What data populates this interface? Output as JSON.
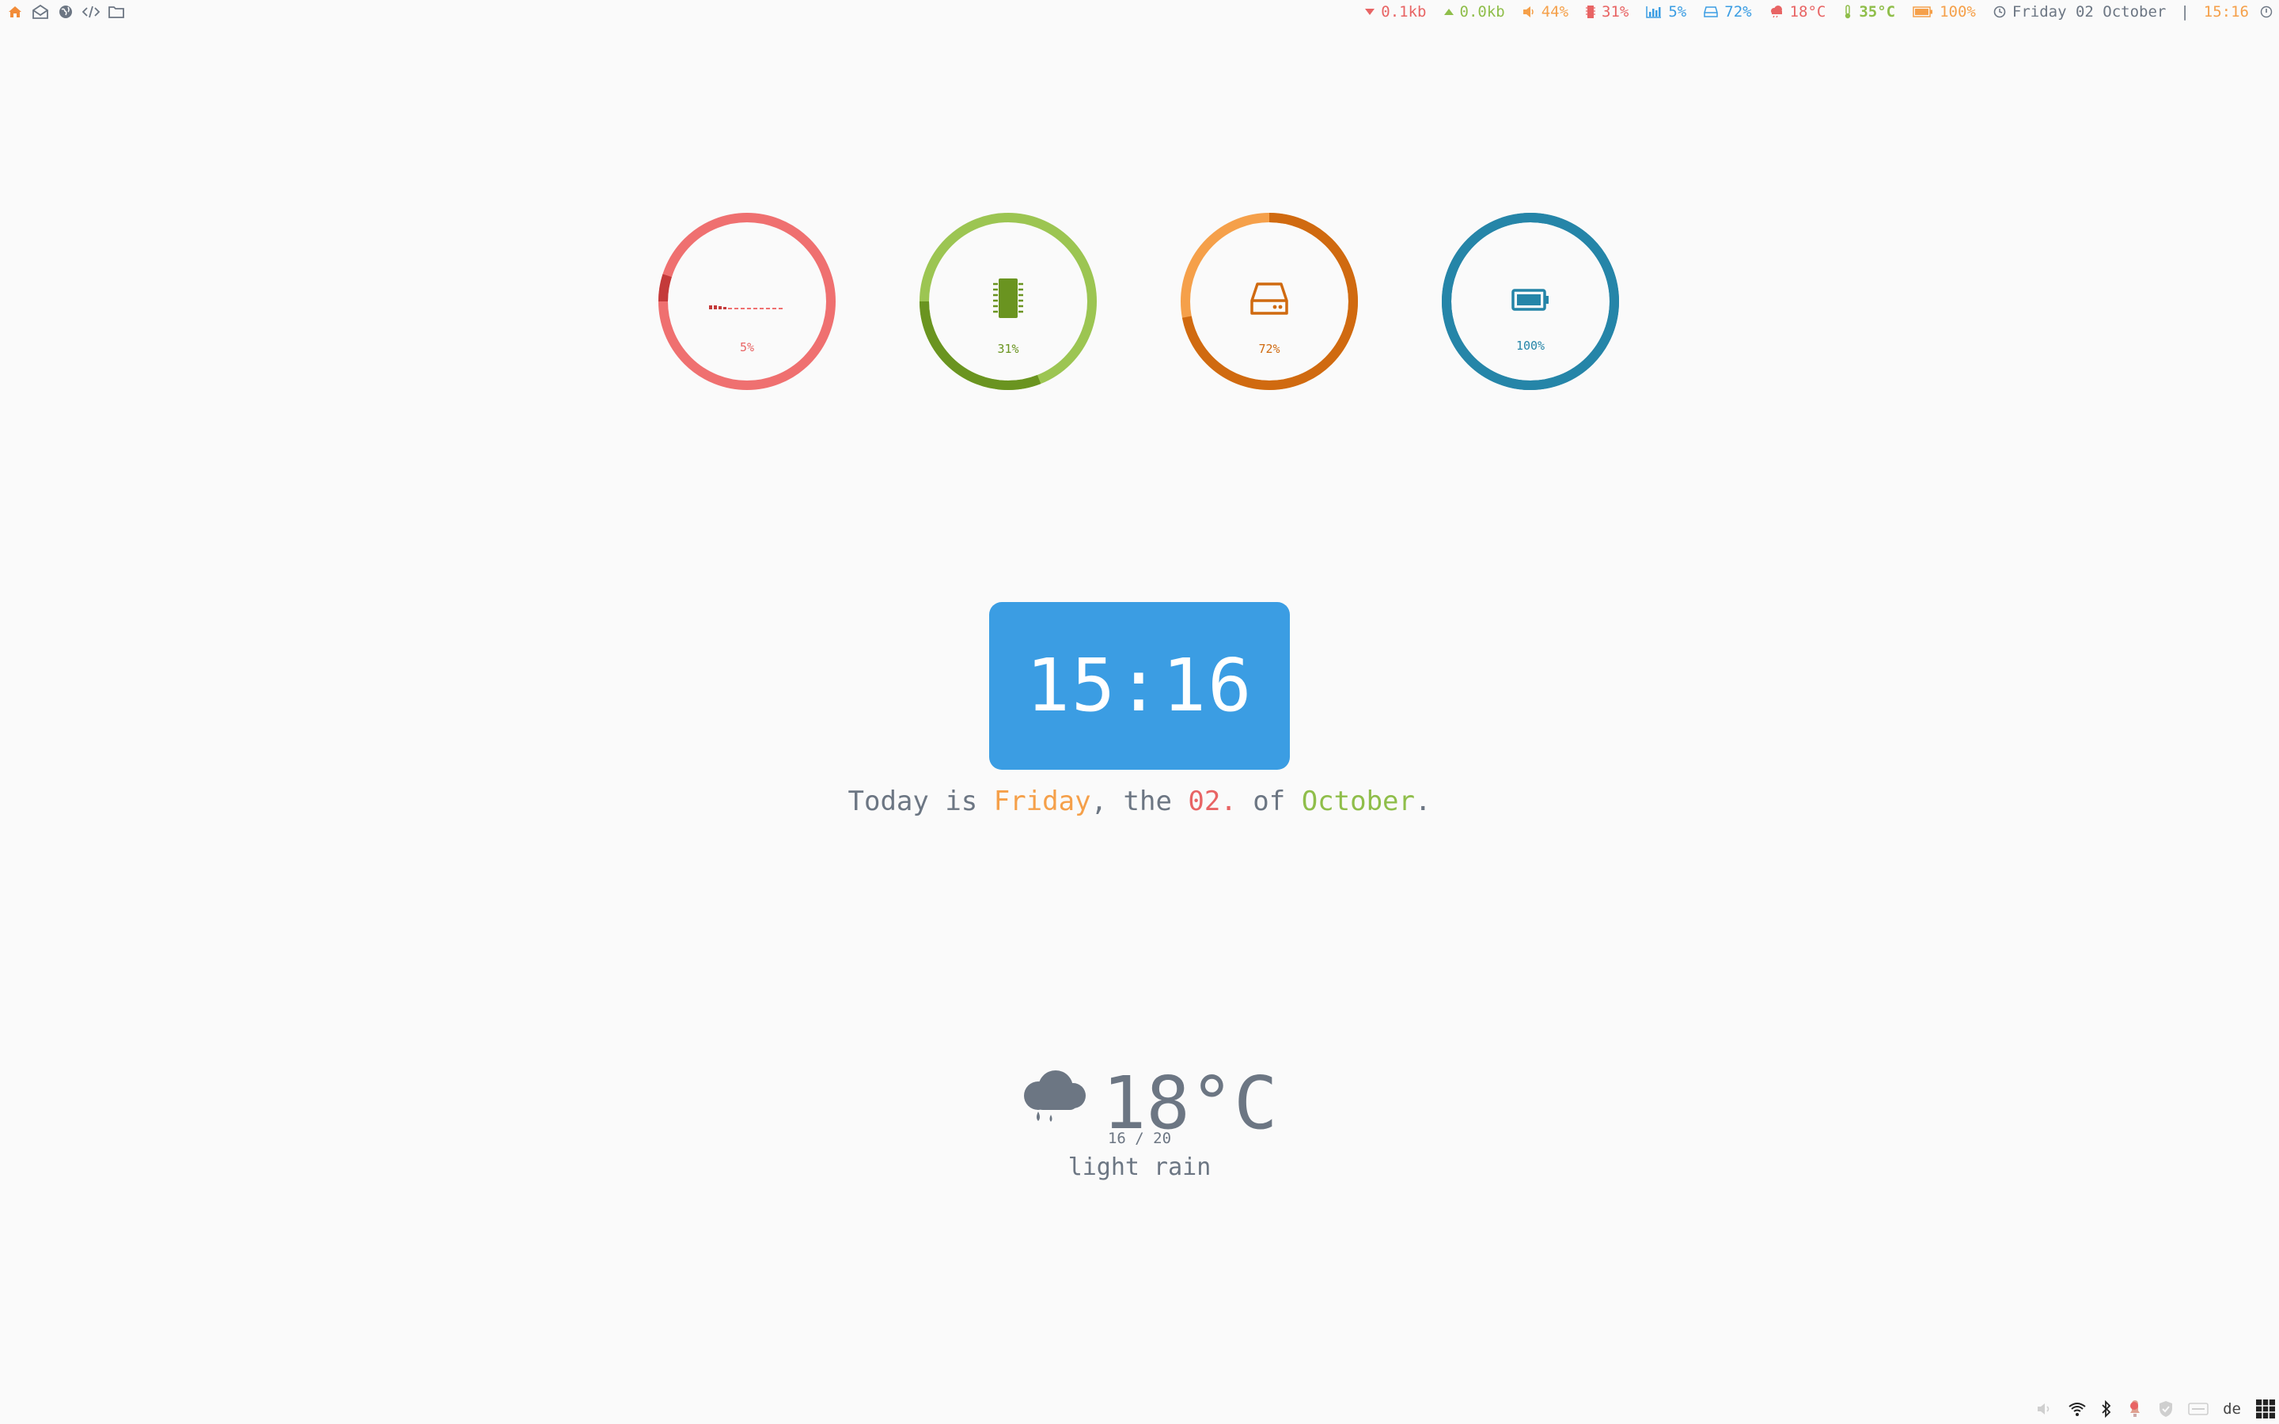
{
  "topbar": {
    "net_down": "0.1kb",
    "net_up": "0.0kb",
    "volume": "44%",
    "memory": "31%",
    "cpu": "5%",
    "disk": "72%",
    "weather": "18°C",
    "cpu_temp": "35°C",
    "battery": "100%",
    "date": "Friday 02 October",
    "separator": "|",
    "time": "15:16",
    "launchers": [
      "home-icon",
      "mail-icon",
      "globe-icon",
      "code-icon",
      "folder-icon"
    ]
  },
  "gauges": [
    {
      "id": "cpu",
      "label": "5%",
      "value": 5,
      "color": "#ef7070",
      "accent": "#c43a3a",
      "icon": "cpu-graph-icon"
    },
    {
      "id": "memory",
      "label": "31%",
      "value": 31,
      "color": "#9cc552",
      "accent": "#6a9420",
      "icon": "memory-chip-icon"
    },
    {
      "id": "disk",
      "label": "72%",
      "value": 72,
      "color": "#f5a04a",
      "accent": "#d06a10",
      "icon": "hard-drive-icon"
    },
    {
      "id": "battery",
      "label": "100%",
      "value": 100,
      "color": "#2585a8",
      "accent": "#2585a8",
      "icon": "battery-icon"
    }
  ],
  "clock": {
    "time": "15:16"
  },
  "date_line": {
    "prefix": "Today is ",
    "day": "Friday",
    "mid1": ", the ",
    "date": "02.",
    "mid2": " of ",
    "month": "October",
    "suffix": ".",
    "colors": {
      "day": "#f5a04a",
      "date": "#e86464",
      "month": "#8fbe4a"
    }
  },
  "weather": {
    "temp": "18°C",
    "range": "16 / 20",
    "description": "light rain",
    "icon": "rain-cloud-icon"
  },
  "tray": {
    "keyboard_layout": "de",
    "icons": [
      "volume-muted-icon",
      "wifi-icon",
      "bluetooth-icon",
      "notification-icon",
      "shield-icon",
      "keyboard-icon",
      "grid-menu-icon"
    ]
  },
  "colors": {
    "red": "#e86464",
    "green": "#8fbe4a",
    "orange": "#f5a04a",
    "blue": "#3b9de3",
    "teal": "#2585a8",
    "text": "#6c7683"
  }
}
